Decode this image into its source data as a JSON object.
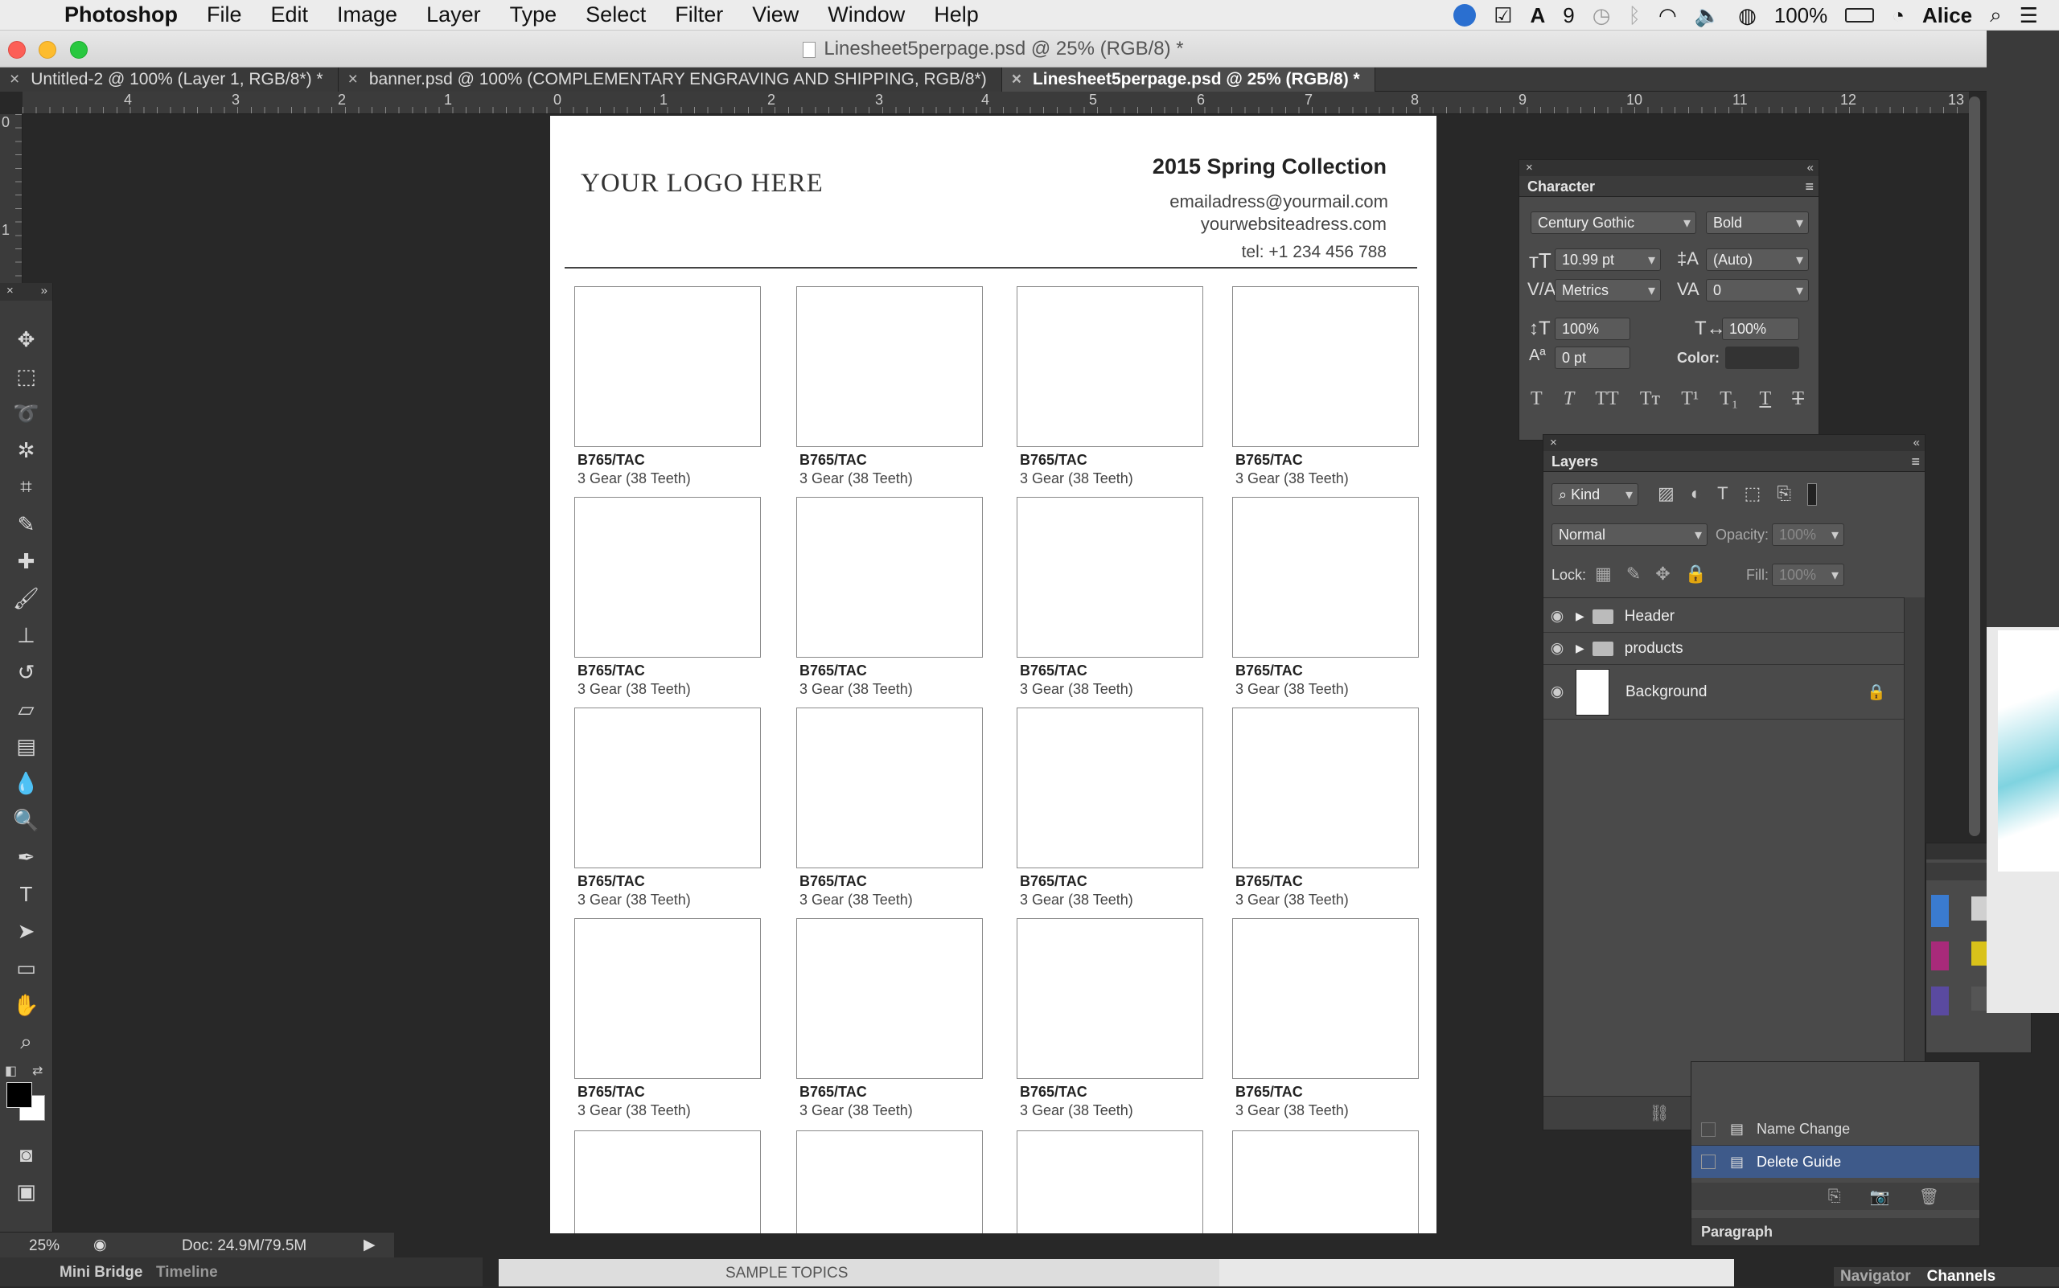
{
  "menubar": {
    "app": "Photoshop",
    "items": [
      "File",
      "Edit",
      "Image",
      "Layer",
      "Type",
      "Select",
      "Filter",
      "View",
      "Window",
      "Help"
    ],
    "status": {
      "adobe_count": "9",
      "battery": "100%",
      "user": "Alice"
    }
  },
  "window": {
    "title": "Linesheet5perpage.psd @ 25% (RGB/8) *"
  },
  "tabs": [
    {
      "label": "Untitled-2 @ 100% (Layer 1, RGB/8*) *"
    },
    {
      "label": "banner.psd @ 100% (COMPLEMENTARY ENGRAVING AND SHIPPING, RGB/8*)"
    },
    {
      "label": "Linesheet5perpage.psd @ 25% (RGB/8) *"
    }
  ],
  "ruler_top": [
    "4",
    "3",
    "2",
    "1",
    "0",
    "1",
    "2",
    "3",
    "4",
    "5",
    "6",
    "7",
    "8",
    "9",
    "10",
    "11",
    "12",
    "13"
  ],
  "ruler_left": [
    "0",
    "1"
  ],
  "document": {
    "logo": "YOUR LOGO HERE",
    "collection": "2015 Spring Collection",
    "email": "emailadress@yourmail.com",
    "website": "yourwebsiteadress.com",
    "tel": "tel: +1 234 456 788",
    "product_sku": "B765/TAC",
    "product_desc": "3 Gear (38 Teeth)"
  },
  "character": {
    "title": "Character",
    "font": "Century Gothic",
    "style": "Bold",
    "size": "10.99 pt",
    "leading": "(Auto)",
    "kerning": "Metrics",
    "tracking": "0",
    "vscale": "100%",
    "hscale": "100%",
    "baseline": "0 pt",
    "color_label": "Color:"
  },
  "layers": {
    "title": "Layers",
    "filter": "Kind",
    "blend": "Normal",
    "opacity_label": "Opacity:",
    "opacity": "100%",
    "lock_label": "Lock:",
    "fill_label": "Fill:",
    "fill": "100%",
    "rows": [
      {
        "name": "Header"
      },
      {
        "name": "products"
      },
      {
        "name": "Background"
      }
    ]
  },
  "history": {
    "items": [
      "Name Change",
      "Delete Guide"
    ]
  },
  "paragraph": {
    "title": "Paragraph"
  },
  "navigator": {
    "tabs": [
      "Navigator",
      "Channels"
    ]
  },
  "status": {
    "zoom": "25%",
    "doc": "Doc: 24.9M/79.5M"
  },
  "bottom_tabs": [
    "Mini Bridge",
    "Timeline"
  ],
  "background_text": "SAMPLE TOPICS"
}
